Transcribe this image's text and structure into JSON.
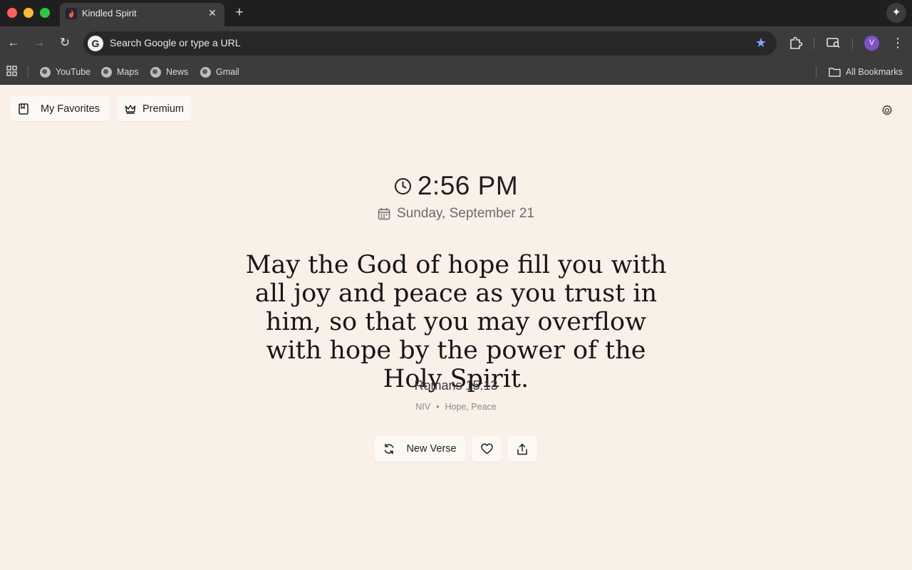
{
  "browser": {
    "tab_title": "Kindled Spirit",
    "omnibox_placeholder": "Search Google or type a URL",
    "avatar_initial": "V",
    "bookmarks": [
      "YouTube",
      "Maps",
      "News",
      "Gmail"
    ],
    "all_bookmarks": "All Bookmarks"
  },
  "page": {
    "favorites_label": "My Favorites",
    "premium_label": "Premium",
    "time": "2:56 PM",
    "date": "Sunday, September 21",
    "verse_text": "May the God of hope fill you with all joy and peace as you trust in him, so that you may overflow with hope by the power of the Holy Spirit.",
    "reference": "Romans 15:13",
    "translation": "NIV",
    "separator": "•",
    "tags": "Hope, Peace",
    "new_verse_label": "New Verse"
  }
}
